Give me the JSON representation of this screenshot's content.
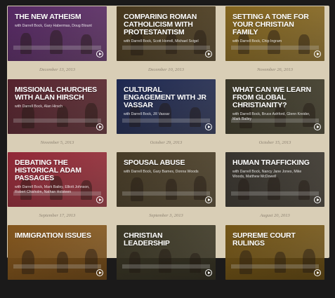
{
  "videos": [
    {
      "title": "THE NEW ATHEISM",
      "subtitle": "with Darrell Bock, Gary Habermas, Doug Blount",
      "date": "December 13, 2013",
      "color": "#5b2a6a"
    },
    {
      "title": "COMPARING ROMAN CATHOLICISM WITH PROTESTANTISM",
      "subtitle": "with Darrell Bock, Scott Horrell, Michael Svigel",
      "date": "December 10, 2013",
      "color": "#4a3a1e"
    },
    {
      "title": "SETTING A TONE FOR YOUR CHRISTIAN FAMILY",
      "subtitle": "with Darrell Bock, Chip Ingram",
      "date": "November 26, 2013",
      "color": "#8a6a20"
    },
    {
      "title": "MISSIONAL CHURCHES WITH ALAN HIRSCH",
      "subtitle": "with Darrell Bock, Alan Hirsch",
      "date": "November 5, 2013",
      "color": "#5a2430"
    },
    {
      "title": "CULTURAL ENGAGEMENT WITH JR VASSAR",
      "subtitle": "with Darrell Bock, JR Vassar",
      "date": "October 29, 2013",
      "color": "#1f2a55"
    },
    {
      "title": "WHAT CAN WE LEARN FROM GLOBAL CHRISTIANITY?",
      "subtitle": "with Darrell Bock, Bruce Ashford, Glenn Kreider, Mark Bailey",
      "date": "October 15, 2013",
      "color": "#3d3a2a"
    },
    {
      "title": "DEBATING THE HISTORICAL ADAM PASSAGES",
      "subtitle": "with Darrell Bock, Mark Bailey, Elliott Johnson, Robert Chisholm, Nathan Holsteen",
      "date": "September 17, 2013",
      "color": "#9a2a3a"
    },
    {
      "title": "SPOUSAL ABUSE",
      "subtitle": "with Darrell Bock, Gary Barnes, Donna Woods",
      "date": "September 3, 2013",
      "color": "#4a3e28"
    },
    {
      "title": "HUMAN TRAFFICKING",
      "subtitle": "with Darrell Bock, Nancy Jane Jones, Mike Woods, Matthew McDowell",
      "date": "August 20, 2013",
      "color": "#3a3630"
    },
    {
      "title": "IMMIGRATION ISSUES",
      "subtitle": "",
      "date": "",
      "color": "#8a5a1e"
    },
    {
      "title": "CHRISTIAN LEADERSHIP",
      "subtitle": "",
      "date": "",
      "color": "#3e3a28"
    },
    {
      "title": "SUPREME COURT RULINGS",
      "subtitle": "",
      "date": "",
      "color": "#7a5a18"
    }
  ]
}
